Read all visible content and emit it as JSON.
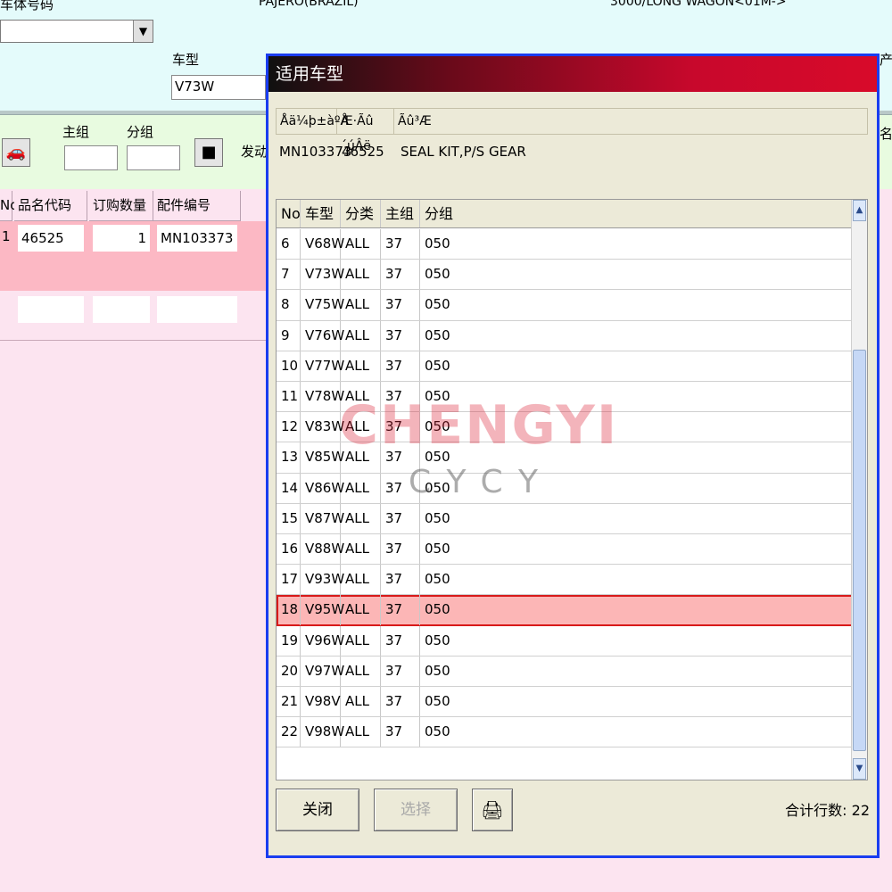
{
  "background": {
    "top_label_left": "车体号码",
    "model_name": "PAJERO(BRAZIL)",
    "model_variant": "3000/LONG WAGON<01M->",
    "vehicle_type_label": "车型",
    "vehicle_type_value": "V73W",
    "right_label_top": "产",
    "right_label_mid": "名",
    "main_group_label": "主组",
    "sub_group_label": "分组",
    "engine_label": "发动",
    "grid_headers": [
      "No",
      "品名代码",
      "订购数量",
      "配件编号"
    ],
    "grid_row": {
      "no": "1",
      "code": "46525",
      "qty": "1",
      "part_no": "MN103373"
    }
  },
  "dialog": {
    "title": "适用车型",
    "info_headers": [
      "Åä¼þ±àºÅ",
      "Æ·Ãû´úÂë",
      "Ãû³Æ"
    ],
    "info_values": {
      "part_no": "MN103373",
      "code": "46525",
      "name": "SEAL KIT,P/S GEAR"
    },
    "grid_headers": [
      "No",
      "车型",
      "分类",
      "主组",
      "分组"
    ],
    "rows": [
      {
        "no": "6",
        "model": "V68W",
        "cat": "ALL",
        "main": "37",
        "sub": "050"
      },
      {
        "no": "7",
        "model": "V73W",
        "cat": "ALL",
        "main": "37",
        "sub": "050"
      },
      {
        "no": "8",
        "model": "V75W",
        "cat": "ALL",
        "main": "37",
        "sub": "050"
      },
      {
        "no": "9",
        "model": "V76W",
        "cat": "ALL",
        "main": "37",
        "sub": "050"
      },
      {
        "no": "10",
        "model": "V77W",
        "cat": "ALL",
        "main": "37",
        "sub": "050"
      },
      {
        "no": "11",
        "model": "V78W",
        "cat": "ALL",
        "main": "37",
        "sub": "050"
      },
      {
        "no": "12",
        "model": "V83W",
        "cat": "ALL",
        "main": "37",
        "sub": "050"
      },
      {
        "no": "13",
        "model": "V85W",
        "cat": "ALL",
        "main": "37",
        "sub": "050"
      },
      {
        "no": "14",
        "model": "V86W",
        "cat": "ALL",
        "main": "37",
        "sub": "050"
      },
      {
        "no": "15",
        "model": "V87W",
        "cat": "ALL",
        "main": "37",
        "sub": "050"
      },
      {
        "no": "16",
        "model": "V88W",
        "cat": "ALL",
        "main": "37",
        "sub": "050"
      },
      {
        "no": "17",
        "model": "V93W",
        "cat": "ALL",
        "main": "37",
        "sub": "050"
      },
      {
        "no": "18",
        "model": "V95W",
        "cat": "ALL",
        "main": "37",
        "sub": "050"
      },
      {
        "no": "19",
        "model": "V96W",
        "cat": "ALL",
        "main": "37",
        "sub": "050"
      },
      {
        "no": "20",
        "model": "V97W",
        "cat": "ALL",
        "main": "37",
        "sub": "050"
      },
      {
        "no": "21",
        "model": "V98V",
        "cat": "ALL",
        "main": "37",
        "sub": "050"
      },
      {
        "no": "22",
        "model": "V98W",
        "cat": "ALL",
        "main": "37",
        "sub": "050"
      }
    ],
    "selected_index": 12,
    "close_label": "关闭",
    "select_label": "选择",
    "print_icon": "printer-icon",
    "count_text": "合计行数: 22"
  },
  "watermark": {
    "brand": "CHENGYI",
    "sub": "CYCY"
  },
  "colors": {
    "selection": "#fcb6b6",
    "selection_border": "#d81a1a",
    "title_start": "#101010",
    "title_end": "#d80a2a"
  }
}
